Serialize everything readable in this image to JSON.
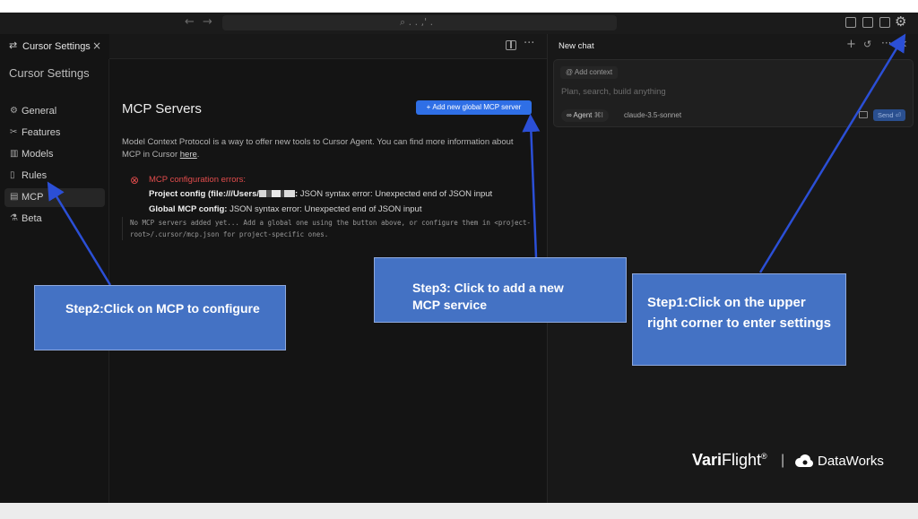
{
  "titlebar": {
    "back_icon": "arrow-left-icon",
    "forward_icon": "arrow-right-icon",
    "search_text": "⌕ . . ,' ."
  },
  "settings_tab": {
    "label": "Cursor Settings",
    "close": "×"
  },
  "sidebar": {
    "title": "Cursor Settings",
    "items": [
      {
        "label": "General",
        "icon": "⚙"
      },
      {
        "label": "Features",
        "icon": "✂"
      },
      {
        "label": "Models",
        "icon": "▥"
      },
      {
        "label": "Rules",
        "icon": "▯"
      },
      {
        "label": "MCP",
        "icon": "▤"
      },
      {
        "label": "Beta",
        "icon": "⚗"
      }
    ],
    "active": "MCP"
  },
  "mcp": {
    "title": "MCP Servers",
    "add_button": "Add new global MCP server",
    "description_pre": "Model Context Protocol is a way to offer new tools to Cursor Agent. You can find more information about MCP in Cursor ",
    "description_link": "here",
    "description_post": ".",
    "errors_title": "MCP configuration errors:",
    "project_label": "Project config (file:///Users/",
    "project_label_end": ":",
    "project_message": " JSON syntax error: Unexpected end of JSON input",
    "global_label": "Global MCP config:",
    "global_message": " JSON syntax error: Unexpected end of JSON input",
    "empty_note": "No MCP servers added yet... Add a global one using the button above, or configure them in <project-root>/.cursor/mcp.json for project-specific ones."
  },
  "chat": {
    "tab": "New chat",
    "add_context": "Add context",
    "placeholder": "Plan, search, build anything",
    "agent": "Agent",
    "agent_shortcut": "⌘I",
    "model": "claude-3.5-sonnet",
    "send": "Send ⏎"
  },
  "annotations": {
    "step1": "Step1:Click on the upper right corner to enter settings",
    "step2": "Step2:Click on MCP to configure",
    "step3": "Step3: Click to add a new MCP service"
  },
  "brand": {
    "vari_bold": "Vari",
    "vari_light": "Flight",
    "mark": "®",
    "separator": "|",
    "dataworks": "DataWorks"
  },
  "colors": {
    "accent_button": "#2f6fe6",
    "callout_fill": "#4472c4",
    "arrow": "#2b4fd6",
    "error": "#e24c4c"
  }
}
